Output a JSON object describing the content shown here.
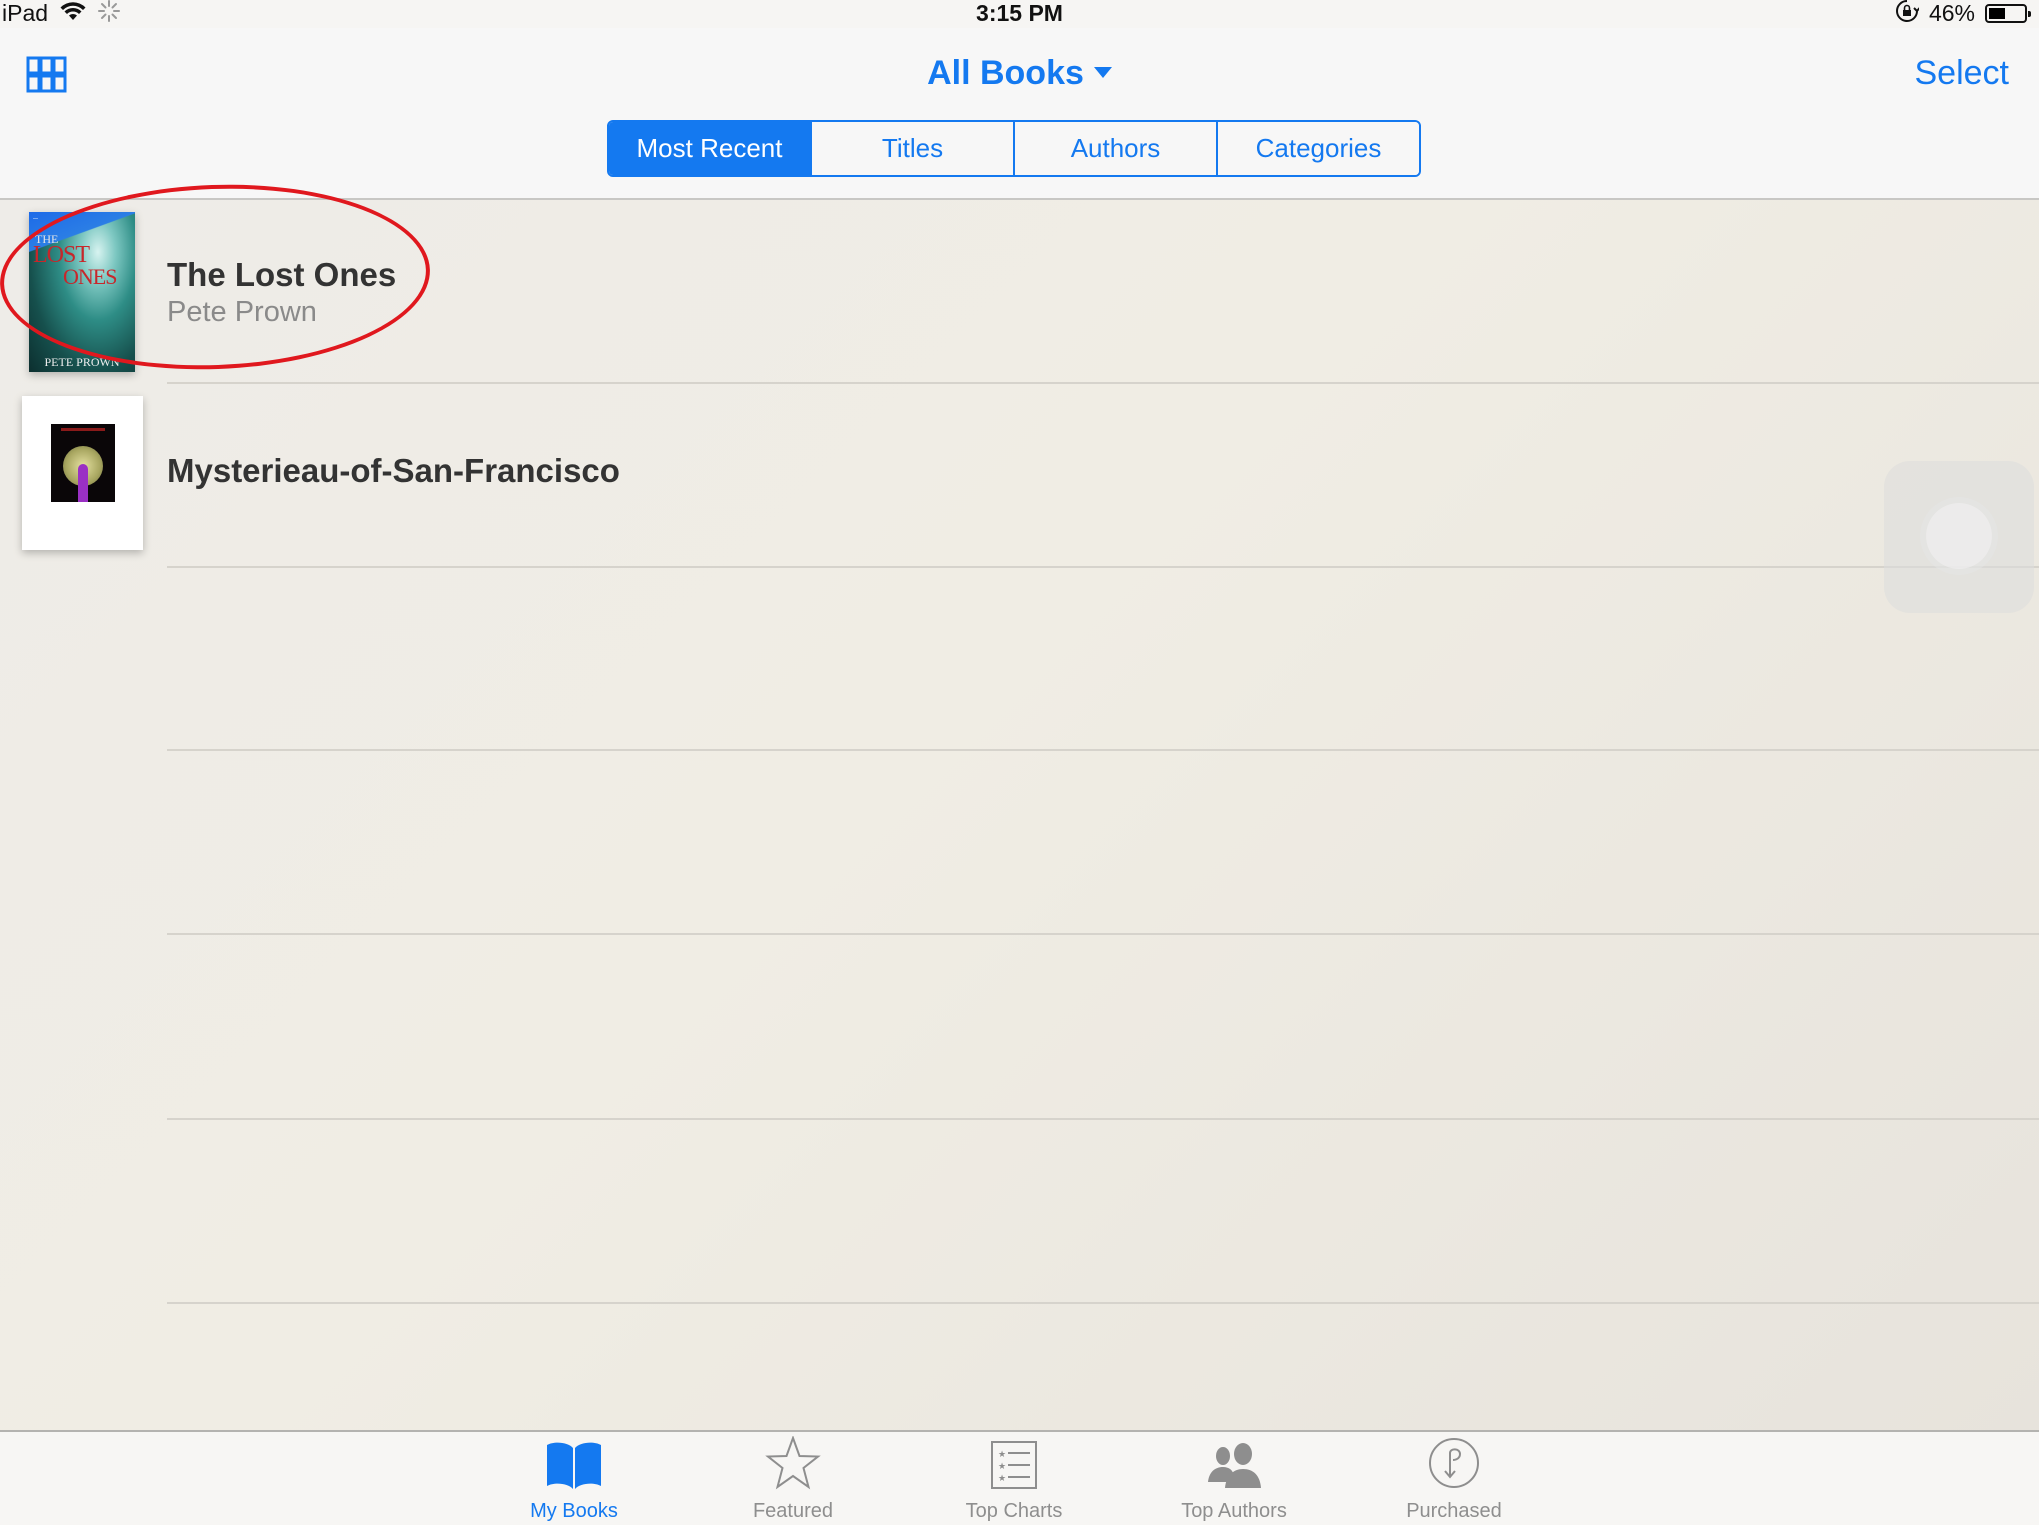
{
  "status_bar": {
    "device": "iPad",
    "time": "3:15 PM",
    "battery_percent_label": "46%",
    "battery_level": 0.46,
    "icons": [
      "wifi-icon",
      "activity-spinner-icon",
      "rotation-lock-icon",
      "battery-icon"
    ]
  },
  "nav": {
    "grid_icon": "grid-view-icon",
    "title": "All Books",
    "select_label": "Select"
  },
  "segments": [
    {
      "label": "Most Recent",
      "active": true
    },
    {
      "label": "Titles",
      "active": false
    },
    {
      "label": "Authors",
      "active": false
    },
    {
      "label": "Categories",
      "active": false
    }
  ],
  "books": [
    {
      "title": "The Lost Ones",
      "author": "Pete Prown",
      "cover": {
        "the": "THE",
        "lost": "LOST",
        "ones": "ONES",
        "author": "PETE PROWN"
      },
      "annotated": true
    },
    {
      "title": "Mysterieau-of-San-Francisco",
      "author": "",
      "annotated": false
    }
  ],
  "tab_bar": [
    {
      "label": "My Books",
      "icon": "book-icon",
      "active": true
    },
    {
      "label": "Featured",
      "icon": "star-icon",
      "active": false
    },
    {
      "label": "Top Charts",
      "icon": "list-icon",
      "active": false
    },
    {
      "label": "Top Authors",
      "icon": "people-icon",
      "active": false
    },
    {
      "label": "Purchased",
      "icon": "purchased-icon",
      "active": false
    }
  ],
  "colors": {
    "accent": "#1479f0",
    "annotation": "#e0181e"
  }
}
